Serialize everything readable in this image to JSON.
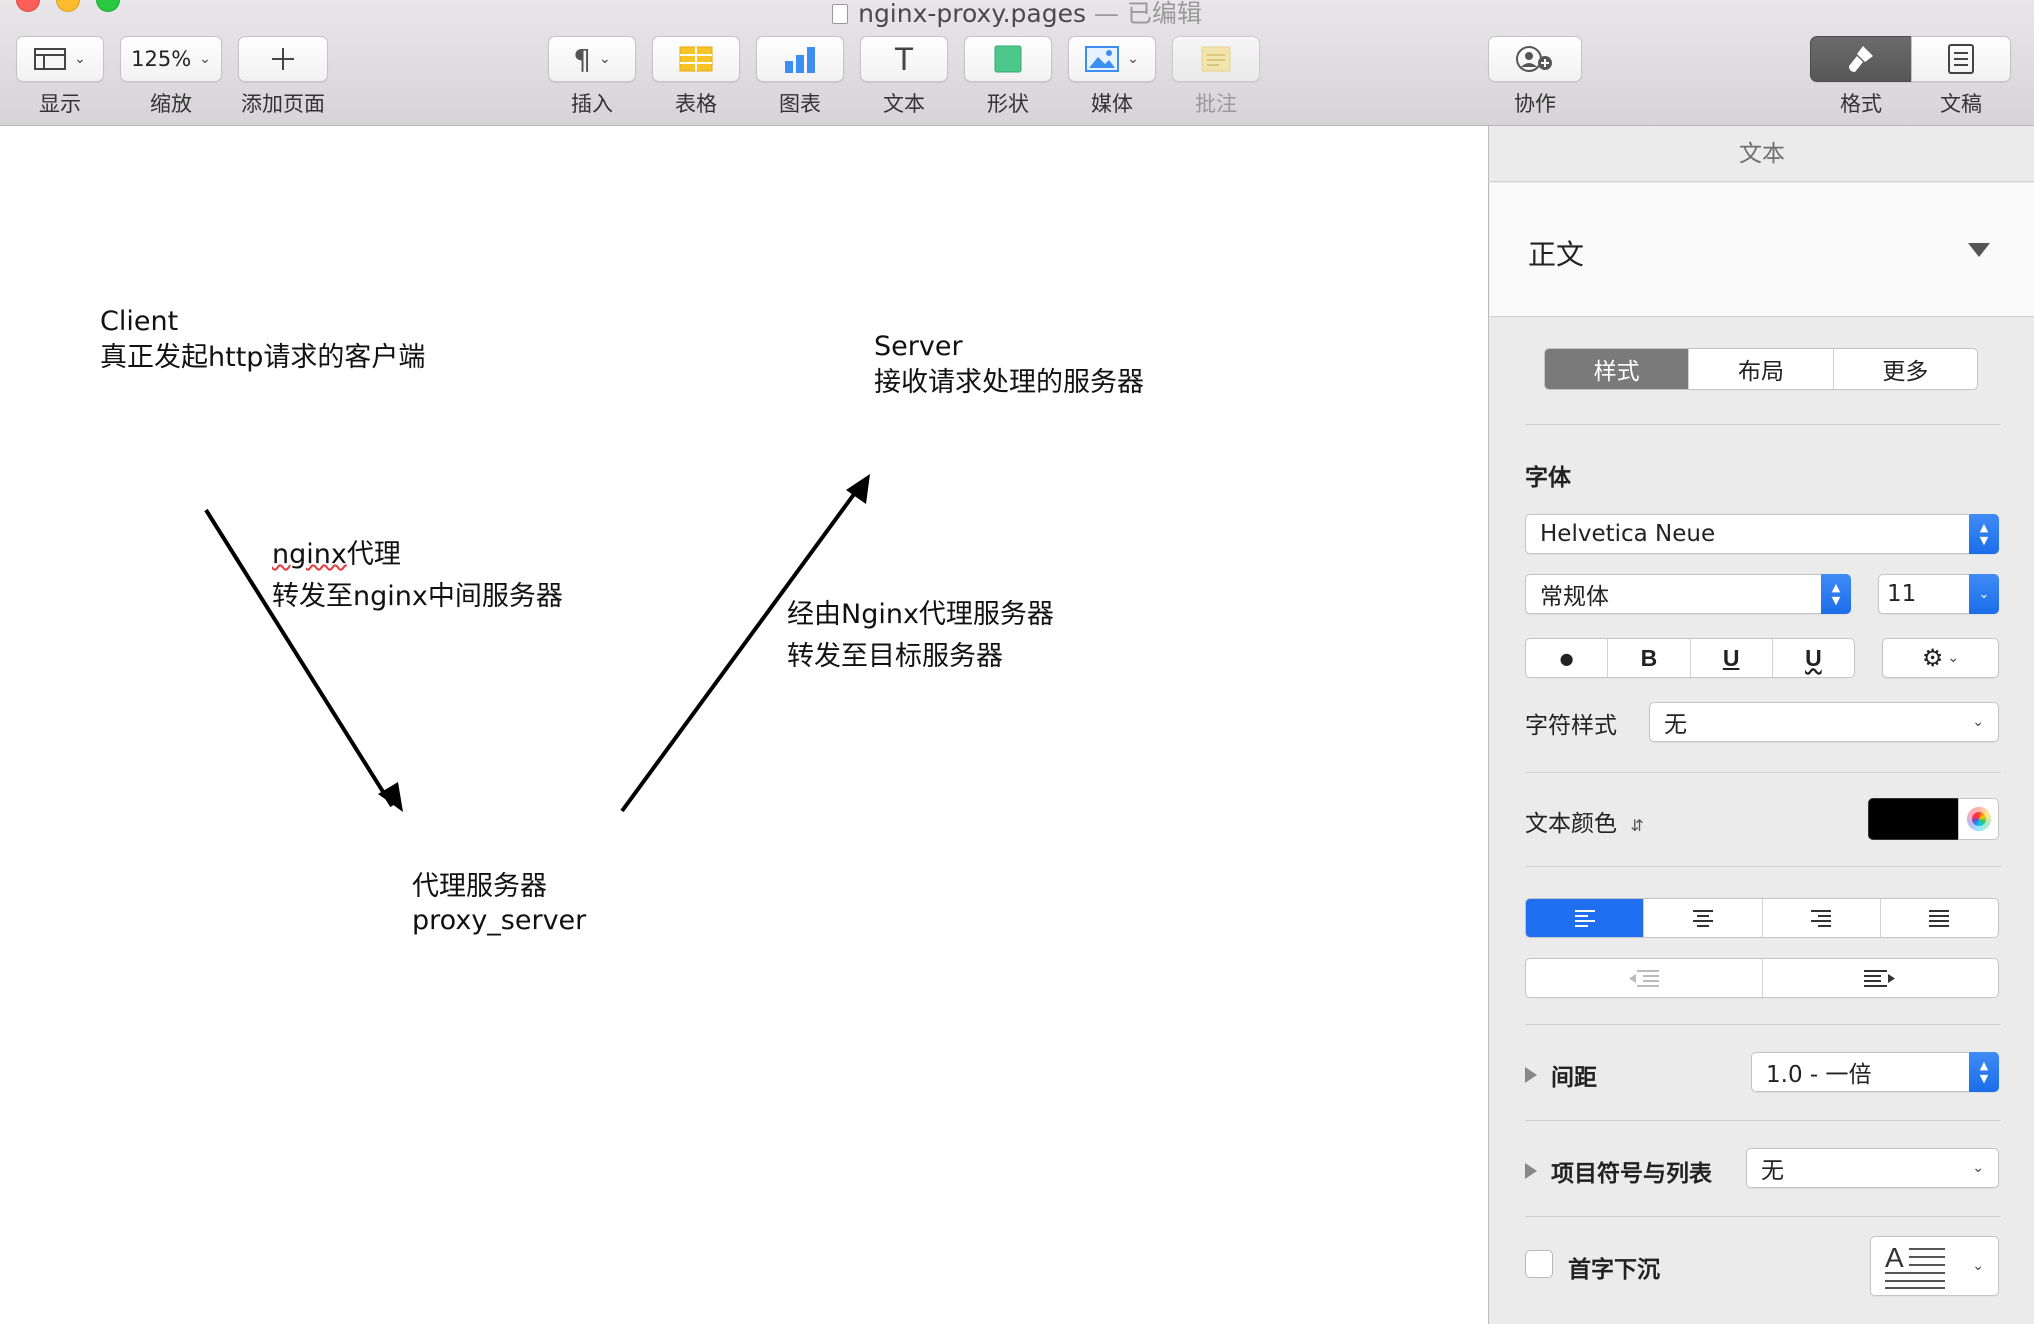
{
  "window": {
    "file_name": "nginx-proxy.pages",
    "separator": " — ",
    "edited": "已编辑"
  },
  "toolbar": {
    "view_label": "显示",
    "zoom_value": "125%",
    "zoom_label": "缩放",
    "add_page_label": "添加页面",
    "insert_label": "插入",
    "table_label": "表格",
    "chart_label": "图表",
    "text_label": "文本",
    "shape_label": "形状",
    "media_label": "媒体",
    "comment_label": "批注",
    "collaborate_label": "协作",
    "format_label": "格式",
    "document_label": "文稿"
  },
  "canvas": {
    "client_title": "Client",
    "client_desc": "真正发起http请求的客户端",
    "server_title": "Server",
    "server_desc": "接收请求处理的服务器",
    "left_arrow_word": "nginx",
    "left_arrow_rest": "代理",
    "left_arrow_line2": "转发至nginx中间服务器",
    "right_arrow_line1": "经由Nginx代理服务器",
    "right_arrow_line2": "转发至目标服务器",
    "proxy_title": "代理服务器",
    "proxy_name": "proxy_server"
  },
  "inspector": {
    "header": "文本",
    "paragraph_style": "正文",
    "tabs": [
      "样式",
      "布局",
      "更多"
    ],
    "font_section": "字体",
    "font_family": "Helvetica Neue",
    "font_weight": "常规体",
    "font_size": "11",
    "bold_label": "B",
    "underline_label": "U",
    "strike_label": "U",
    "char_style_label": "字符样式",
    "char_style_value": "无",
    "text_color_label": "文本颜色",
    "text_color": "#000000",
    "spacing_label": "间距",
    "spacing_value": "1.0 - 一倍",
    "bullets_label": "项目符号与列表",
    "bullets_value": "无",
    "dropcap_label": "首字下沉"
  },
  "colors": {
    "accent": "#1f6ff0",
    "traffic_red": "#fc5f57",
    "traffic_yellow": "#fdbc2e",
    "traffic_green": "#28c840"
  }
}
